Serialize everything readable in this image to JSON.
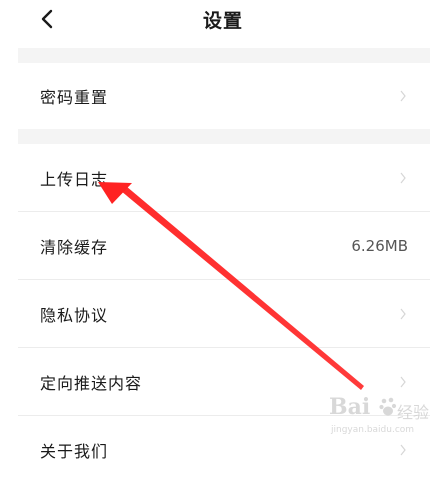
{
  "header": {
    "title": "设置",
    "back_icon": "chevron-left-icon"
  },
  "settings": {
    "items": [
      {
        "label": "密码重置",
        "value": "",
        "chevron": true
      },
      {
        "label": "上传日志",
        "value": "",
        "chevron": true
      },
      {
        "label": "清除缓存",
        "value": "6.26MB",
        "chevron": false
      },
      {
        "label": "隐私协议",
        "value": "",
        "chevron": true
      },
      {
        "label": "定向推送内容",
        "value": "",
        "chevron": true
      },
      {
        "label": "关于我们",
        "value": "",
        "chevron": true
      }
    ]
  },
  "annotation": {
    "arrow_color": "#ff2a2a",
    "target": "上传日志"
  },
  "watermark": {
    "brand": "Bai",
    "word": "经验",
    "url": "jingyan.baidu.com"
  },
  "colors": {
    "background": "#ffffff",
    "section_gap": "#f4f4f4",
    "divider": "#ececec",
    "text": "#1a1a1a",
    "chevron": "#d6d6d6"
  }
}
